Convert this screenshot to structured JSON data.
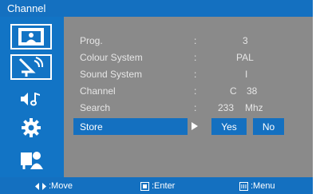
{
  "window": {
    "title": "Channel"
  },
  "sidebar": {
    "items": [
      {
        "icon": "picture-icon"
      },
      {
        "icon": "antenna-icon",
        "selected": true
      },
      {
        "icon": "sound-icon"
      },
      {
        "icon": "gear-icon"
      },
      {
        "icon": "people-icon"
      }
    ]
  },
  "menu": {
    "rows": [
      {
        "label": "Prog.",
        "colon": ":",
        "value": "3"
      },
      {
        "label": "Colour System",
        "colon": ":",
        "value": "PAL"
      },
      {
        "label": "Sound System",
        "colon": ":",
        "value": "I"
      },
      {
        "label": "Channel",
        "colon": ":",
        "value": "C",
        "value2": "38"
      },
      {
        "label": "Search",
        "colon": ":",
        "value": "233",
        "value2": "Mhz"
      }
    ],
    "store": {
      "label": "Store",
      "yes": "Yes",
      "no": "No"
    }
  },
  "footer": {
    "move": ":Move",
    "enter": ":Enter",
    "menu": ":Menu"
  },
  "colors": {
    "accent": "#1470c0",
    "panel": "#8a8a8a"
  }
}
